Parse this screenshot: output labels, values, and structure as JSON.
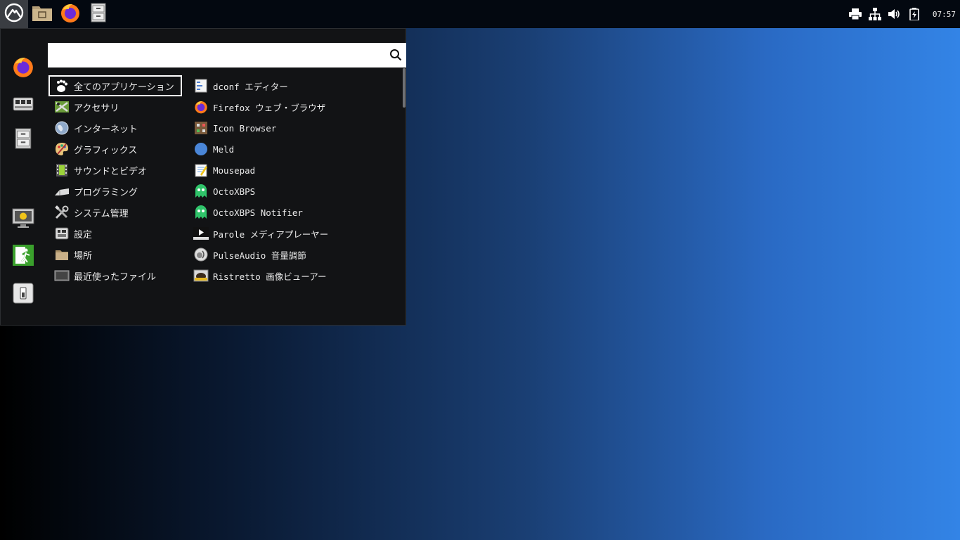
{
  "panel": {
    "launchers": [
      {
        "name": "menu-logo-icon"
      },
      {
        "name": "file-manager-icon"
      },
      {
        "name": "firefox-icon"
      },
      {
        "name": "filing-cabinet-icon"
      }
    ],
    "clock": "07:57"
  },
  "menu": {
    "search": {
      "value": "",
      "placeholder": ""
    },
    "categories": [
      {
        "label": "全てのアプリケーション",
        "icon": "gnome-foot-icon"
      },
      {
        "label": "アクセサリ",
        "icon": "accessories-icon"
      },
      {
        "label": "インターネット",
        "icon": "globe-icon"
      },
      {
        "label": "グラフィックス",
        "icon": "palette-icon"
      },
      {
        "label": "サウンドとビデオ",
        "icon": "film-icon"
      },
      {
        "label": "プログラミング",
        "icon": "programming-icon"
      },
      {
        "label": "システム管理",
        "icon": "tools-icon"
      },
      {
        "label": "設定",
        "icon": "settings-icon"
      },
      {
        "label": "場所",
        "icon": "folder-icon"
      },
      {
        "label": "最近使ったファイル",
        "icon": "recent-files-icon"
      }
    ],
    "apps": [
      {
        "label": "dconf エディター",
        "icon": "dconf-icon"
      },
      {
        "label": "Firefox ウェブ・ブラウザ",
        "icon": "firefox-icon"
      },
      {
        "label": "Icon Browser",
        "icon": "icon-browser-icon"
      },
      {
        "label": "Meld",
        "icon": "meld-icon"
      },
      {
        "label": "Mousepad",
        "icon": "mousepad-icon"
      },
      {
        "label": "OctoXBPS",
        "icon": "ghost-icon"
      },
      {
        "label": "OctoXBPS Notifier",
        "icon": "ghost-icon"
      },
      {
        "label": "Parole メディアプレーヤー",
        "icon": "media-player-icon"
      },
      {
        "label": "PulseAudio 音量調節",
        "icon": "speaker-icon"
      },
      {
        "label": "Ristretto 画像ビューアー",
        "icon": "image-viewer-icon"
      }
    ]
  },
  "colors": {
    "accent": "#2a6ac4",
    "menu_bg": "#121315",
    "panel_bg": "#030810"
  }
}
